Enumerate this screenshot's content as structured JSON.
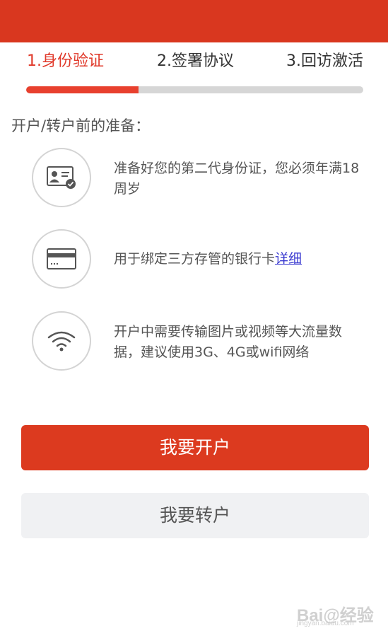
{
  "steps": [
    {
      "label": "1.身份验证"
    },
    {
      "label": "2.签署协议"
    },
    {
      "label": "3.回访激活"
    }
  ],
  "progress": {
    "value": 0.333
  },
  "colors": {
    "primary": "#d9371f",
    "active_step": "#e0392a",
    "link": "#3a3ad0",
    "secondary_button": "#f0f1f3"
  },
  "section_title": "开户/转户前的准备：",
  "items": [
    {
      "icon": "id-card-icon",
      "text": "准备好您的第二代身份证，您必须年满18周岁"
    },
    {
      "icon": "bank-card-icon",
      "text": "用于绑定三方存管的银行卡",
      "link": "详细"
    },
    {
      "icon": "wifi-icon",
      "text": "开户中需要传输图片或视频等大流量数据，建议使用3G、4G或wifi网络"
    }
  ],
  "buttons": {
    "open_account": "我要开户",
    "transfer_account": "我要转户"
  },
  "watermark": {
    "main": "Bai@经验",
    "sub": "jingyan.baidu.com"
  }
}
